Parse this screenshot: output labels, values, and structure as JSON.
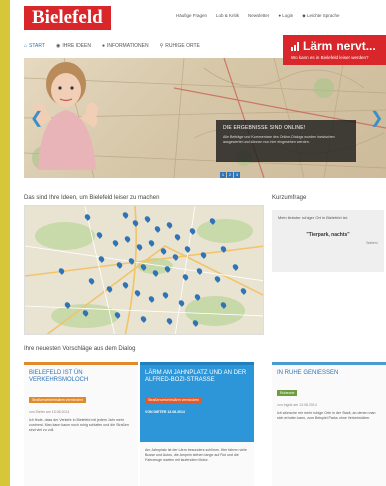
{
  "header": {
    "logo": "Bielefeld",
    "links": [
      "Häufige Fragen",
      "Lob & Kritik",
      "Newsletter"
    ],
    "login": "Login",
    "simple_language": "Leichte Sprache"
  },
  "nav": {
    "items": [
      {
        "label": "START",
        "icon": "home-icon"
      },
      {
        "label": "IHRE IDEEN",
        "icon": "chat-icon"
      },
      {
        "label": "INFORMATIONEN",
        "icon": "info-icon"
      },
      {
        "label": "RUHIGE ORTE",
        "icon": "pin-icon"
      }
    ]
  },
  "badge": {
    "title_a": "Lärm",
    "title_b": "nervt...",
    "subtitle": "Wo kann es in Bielefeld leiser werden?"
  },
  "hero": {
    "box_title": "DIE ERGEBNISSE SIND ONLINE!",
    "box_text": "Alle Beiträge und Kommentare des Online-Dialogs wurden inzwischen ausgewertet und können nun hier eingesehen werden.",
    "slides": [
      "1",
      "2",
      "3"
    ]
  },
  "ideas": {
    "title": "Das sind Ihre Ideen, um Bielefeld leiser zu machen"
  },
  "survey": {
    "title": "Kurzumfrage",
    "question": "Mein liebster ruhiger Ort in Bielefeld ist:",
    "quote": "\"Tierpark, nachts\"",
    "source": "Waltern"
  },
  "proposals": {
    "title": "Ihre neuesten Vorschläge aus dem Dialog",
    "cards": [
      {
        "title": "BIELEFELD IST ÜN VERKEHRSMOLOCH",
        "tag": "Straßenverkehrslärm vermindern",
        "date": "von Dieter am 15.08.2014",
        "text": "Ich finde, dass der Verkehr in Bielefeld mit jedem Jahr mehr zunimmt. Man kann kaum noch ruhig schlafen und die Straßen sind viel zu voll."
      },
      {
        "title": "LÄRM AM JAHNPLATZ UND AN DER ALFRED-BOZI-STRASSE",
        "tag": "Straßenverkehrslärm vermindern",
        "date": "VON DIETER 13.08.2014",
        "text": "Am Jahnplatz ist der Lärm besonders schlimm. Hier fahren viele Busse und Autos, die Ampeln stehen lange auf Rot und die Fahrzeuge warten mit laufendem Motor."
      },
      {
        "title": "IN RUHE GENIESSEN",
        "tag": "Ruheorte",
        "date": "von Ingrid am 13.08.2014",
        "text": "Ich wünsche mir mehr ruhige Orte in der Stadt, an denen man sich erholen kann, zum Beispiel Parks ohne Verkehrslärm."
      }
    ]
  },
  "colors": {
    "brand_red": "#d8262b",
    "accent_blue": "#2f74b7",
    "tag_orange": "#e08a2c",
    "tag_green": "#6f9c3f",
    "card_blue": "#2c96d8",
    "outer_yellow": "#d6c63a"
  }
}
